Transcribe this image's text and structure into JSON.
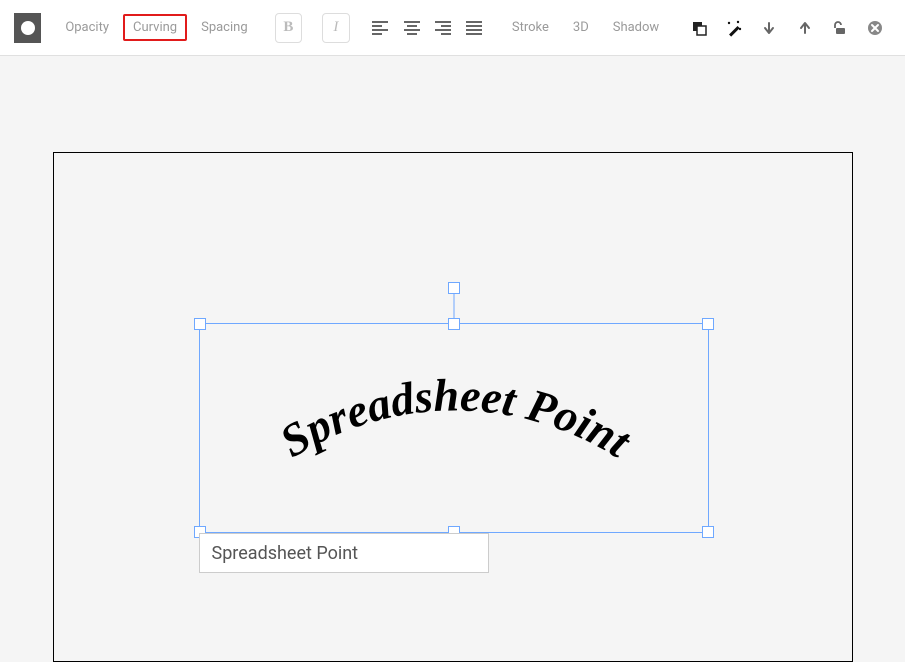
{
  "toolbar": {
    "opacity_label": "Opacity",
    "curving_label": "Curving",
    "spacing_label": "Spacing",
    "bold_letter": "B",
    "italic_letter": "I",
    "stroke_label": "Stroke",
    "three_d_label": "3D",
    "shadow_label": "Shadow"
  },
  "text_element": {
    "content": "Spreadsheet Point",
    "input_value": "Spreadsheet Point"
  },
  "colors": {
    "selection": "#6fa8ff",
    "highlight_border": "#e11b1b",
    "swatch_bg": "#555555"
  }
}
